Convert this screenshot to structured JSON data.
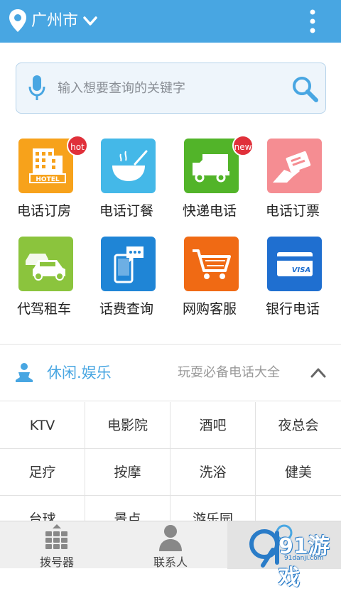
{
  "header": {
    "city": "广州市",
    "location_icon": "location-pin-icon",
    "menu_icon": "more-vertical-icon"
  },
  "search": {
    "placeholder": "输入想要查询的关键字",
    "mic_icon": "microphone-icon",
    "search_icon": "search-icon"
  },
  "services": [
    {
      "label": "电话订房",
      "icon": "hotel-icon",
      "color": "#f7a21b",
      "badge": "hot"
    },
    {
      "label": "电话订餐",
      "icon": "food-bowl-icon",
      "color": "#44b8e8",
      "badge": ""
    },
    {
      "label": "快递电话",
      "icon": "delivery-truck-icon",
      "color": "#52b429",
      "badge": "new"
    },
    {
      "label": "电话订票",
      "icon": "ticket-icon",
      "color": "#f58d92",
      "badge": ""
    },
    {
      "label": "代驾租车",
      "icon": "car-icon",
      "color": "#8bc43d",
      "badge": ""
    },
    {
      "label": "话费查询",
      "icon": "phone-chat-icon",
      "color": "#1f85d6",
      "badge": ""
    },
    {
      "label": "网购客服",
      "icon": "shopping-cart-icon",
      "color": "#f06a14",
      "badge": ""
    },
    {
      "label": "银行电话",
      "icon": "bank-card-icon",
      "color": "#1f6fd0",
      "badge": ""
    }
  ],
  "section": {
    "title": "休闲.娱乐",
    "subtitle": "玩耍必备电话大全",
    "icon": "meditation-person-icon",
    "toggle_icon": "chevron-up-icon"
  },
  "entertainment": [
    "KTV",
    "电影院",
    "酒吧",
    "夜总会",
    "足疗",
    "按摩",
    "洗浴",
    "健美",
    "台球",
    "景点",
    "游乐园",
    ""
  ],
  "bottom_nav": [
    {
      "label": "拨号器",
      "icon": "dialpad-icon"
    },
    {
      "label": "联系人",
      "icon": "contact-person-icon"
    },
    {
      "label": "",
      "icon": "phone-tab-icon"
    }
  ],
  "watermark": {
    "text": "91游戏",
    "url": "91danji.com"
  },
  "colors": {
    "primary": "#48a6e2",
    "badge": "#e0303a"
  }
}
